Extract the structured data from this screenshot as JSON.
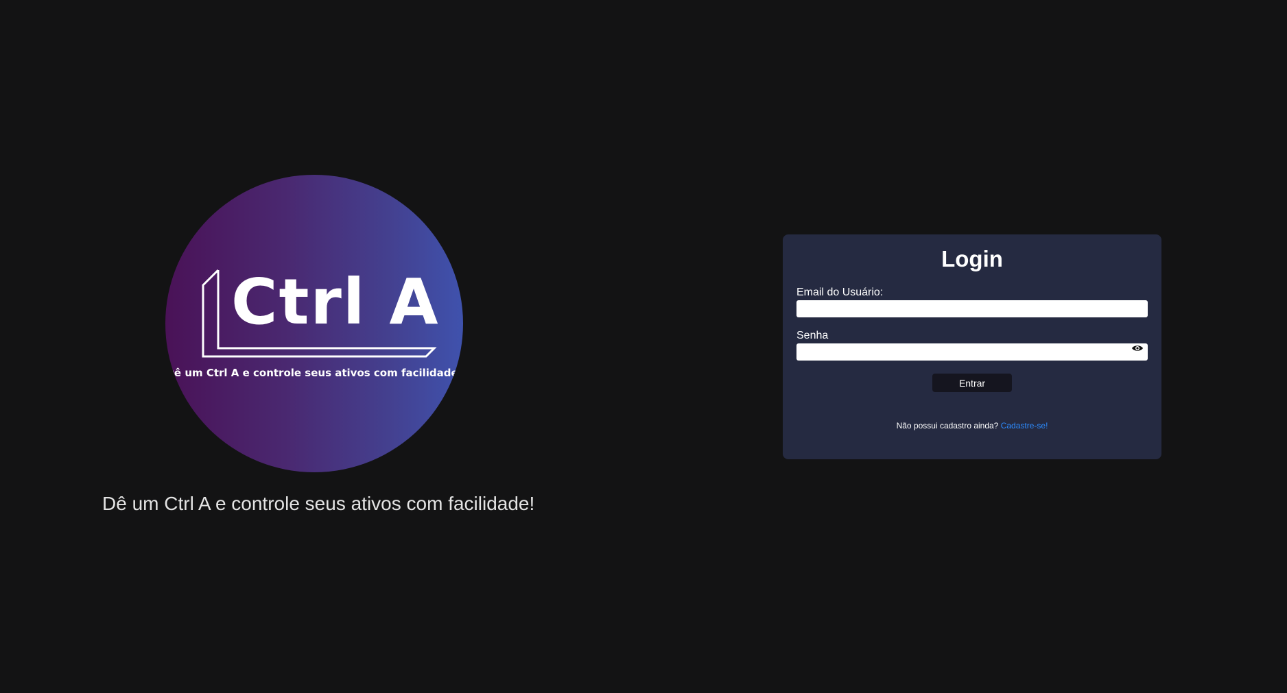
{
  "brand": {
    "logo_wordmark": "Ctrl A",
    "logo_tagline": "Dê um Ctrl A e controle seus ativos com facilidade!",
    "slogan": "Dê um Ctrl A e controle seus ativos com facilidade!",
    "gradient_colors": [
      "#4a1257",
      "#3f52ad"
    ]
  },
  "login": {
    "title": "Login",
    "email_label": "Email do Usuário:",
    "email_value": "",
    "password_label": "Senha",
    "password_value": "",
    "password_toggle_icon": "eye-icon",
    "submit_label": "Entrar",
    "register_prompt": "Não possui cadastro ainda?",
    "register_link": "Cadastre-se!"
  },
  "colors": {
    "background": "#131314",
    "card": "#252a41",
    "button": "#15151f",
    "link": "#2d8cff"
  }
}
